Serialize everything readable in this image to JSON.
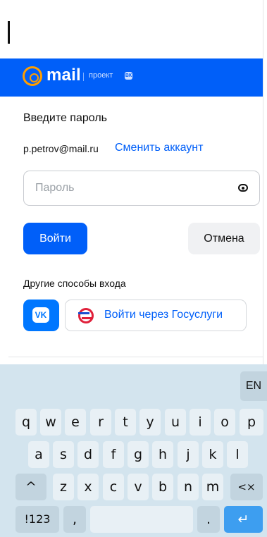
{
  "header": {
    "logo_text": "mail",
    "project_label": "проект",
    "project_badge": "ВК"
  },
  "form": {
    "title": "Введите пароль",
    "email": "p.petrov@mail.ru",
    "switch_account": "Сменить аккаунт",
    "password_placeholder": "Пароль",
    "password_value": "",
    "login_button": "Войти",
    "cancel_button": "Отмена",
    "other_methods": "Другие способы входа",
    "vk_label": "VK",
    "gosuslugi_button": "Войти через Госуслуги"
  },
  "keyboard": {
    "language": "EN",
    "row1": [
      "q",
      "w",
      "e",
      "r",
      "t",
      "y",
      "u",
      "i",
      "o",
      "p"
    ],
    "row2": [
      "a",
      "s",
      "d",
      "f",
      "g",
      "h",
      "j",
      "k",
      "l"
    ],
    "row3": [
      "z",
      "x",
      "c",
      "v",
      "b",
      "n",
      "m"
    ],
    "shift": "^",
    "backspace": "<×",
    "numbers": "!123",
    "comma": ",",
    "period": ".",
    "enter": "↵"
  },
  "colors": {
    "brand_blue": "#005ff9",
    "mail_orange": "#ff9e00",
    "vk_blue": "#0077ff"
  }
}
